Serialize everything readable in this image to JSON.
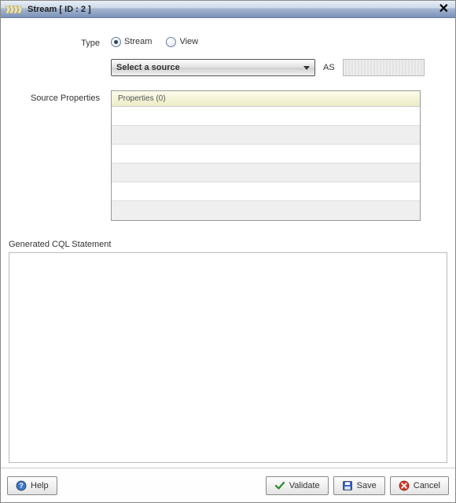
{
  "window": {
    "title": "Stream [ ID : 2 ]"
  },
  "form": {
    "type_label": "Type",
    "radio_stream": "Stream",
    "radio_view": "View",
    "selected_type": "Stream",
    "source_dropdown": "Select a source",
    "as_label": "AS",
    "as_value": "",
    "source_props_label": "Source Properties",
    "props_header": "Properties (0)"
  },
  "cql": {
    "label": "Generated CQL Statement",
    "value": ""
  },
  "footer": {
    "help": "Help",
    "validate": "Validate",
    "save": "Save",
    "cancel": "Cancel"
  }
}
